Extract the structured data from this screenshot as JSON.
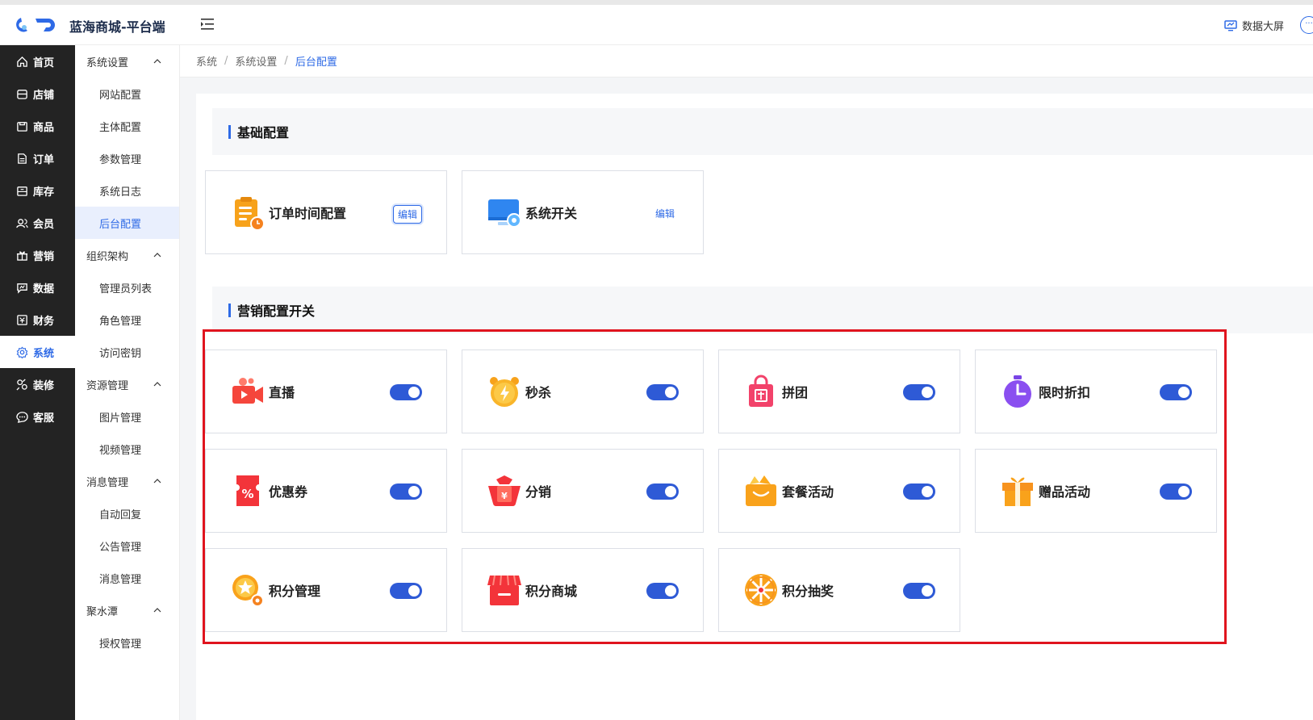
{
  "header": {
    "brand": "蓝海商城-平台端",
    "data_screen_label": "数据大屏"
  },
  "sidebar": {
    "items": [
      {
        "label": "首页",
        "icon": "home-icon"
      },
      {
        "label": "店铺",
        "icon": "store-icon"
      },
      {
        "label": "商品",
        "icon": "goods-icon"
      },
      {
        "label": "订单",
        "icon": "order-icon"
      },
      {
        "label": "库存",
        "icon": "inventory-icon"
      },
      {
        "label": "会员",
        "icon": "member-icon"
      },
      {
        "label": "营销",
        "icon": "gift-icon"
      },
      {
        "label": "数据",
        "icon": "chart-icon"
      },
      {
        "label": "财务",
        "icon": "finance-icon"
      },
      {
        "label": "系统",
        "icon": "gear-icon",
        "active": true
      },
      {
        "label": "装修",
        "icon": "decorate-icon"
      },
      {
        "label": "客服",
        "icon": "chat-icon"
      }
    ]
  },
  "submenu": {
    "groups": [
      {
        "label": "系统设置",
        "items": [
          "网站配置",
          "主体配置",
          "参数管理",
          "系统日志",
          "后台配置"
        ]
      },
      {
        "label": "组织架构",
        "items": [
          "管理员列表",
          "角色管理",
          "访问密钥"
        ]
      },
      {
        "label": "资源管理",
        "items": [
          "图片管理",
          "视频管理"
        ]
      },
      {
        "label": "消息管理",
        "items": [
          "自动回复",
          "公告管理",
          "消息管理"
        ]
      },
      {
        "label": "聚水潭",
        "items": [
          "授权管理"
        ]
      }
    ],
    "active_item": "后台配置"
  },
  "breadcrumb": [
    "系统",
    "系统设置",
    "后台配置"
  ],
  "basic_config": {
    "title": "基础配置",
    "cards": [
      {
        "label": "订单时间配置",
        "action": "编辑"
      },
      {
        "label": "系统开关",
        "action": "编辑"
      }
    ]
  },
  "marketing_config": {
    "title": "营销配置开关",
    "cards": [
      {
        "label": "直播",
        "enabled": true
      },
      {
        "label": "秒杀",
        "enabled": true
      },
      {
        "label": "拼团",
        "enabled": true
      },
      {
        "label": "限时折扣",
        "enabled": true
      },
      {
        "label": "优惠券",
        "enabled": true
      },
      {
        "label": "分销",
        "enabled": true
      },
      {
        "label": "套餐活动",
        "enabled": true
      },
      {
        "label": "赠品活动",
        "enabled": true
      },
      {
        "label": "积分管理",
        "enabled": true
      },
      {
        "label": "积分商城",
        "enabled": true
      },
      {
        "label": "积分抽奖",
        "enabled": true
      }
    ]
  },
  "colors": {
    "accent": "#2e6ae6",
    "sidebar_bg": "#232323",
    "highlight": "#e0141e"
  }
}
